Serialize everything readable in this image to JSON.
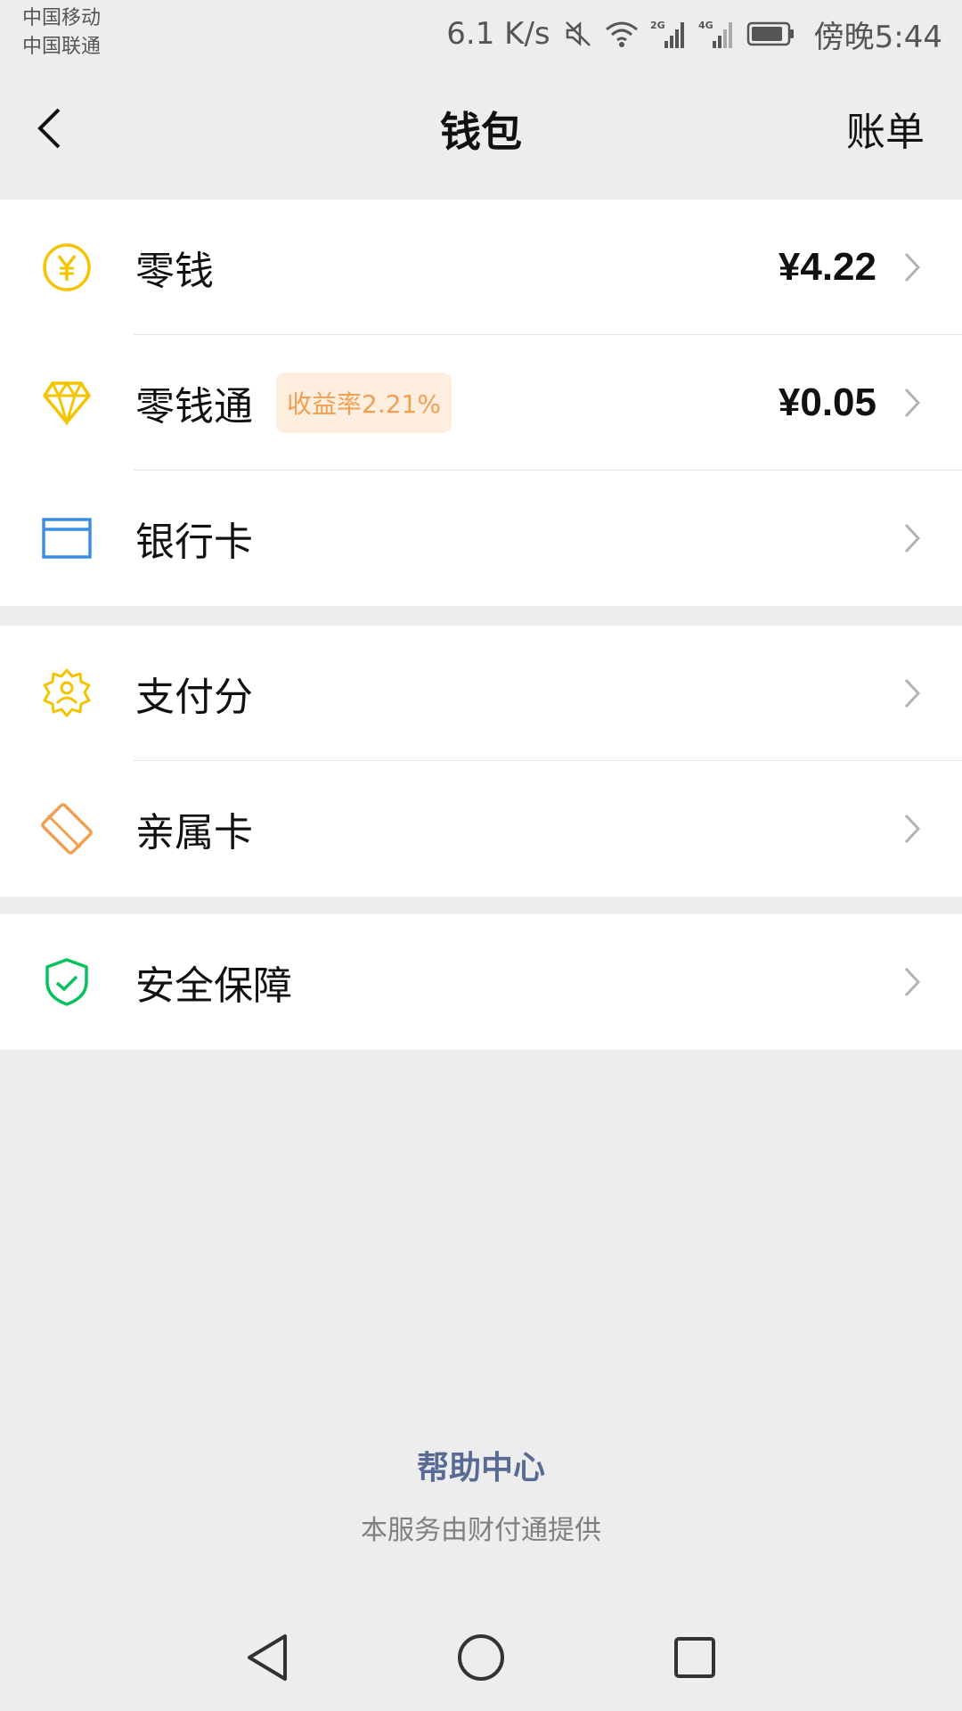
{
  "status_bar": {
    "carrier1": "中国移动",
    "carrier2": "中国联通",
    "speed": "6.1 K/s",
    "time": "傍晚5:44",
    "icons": [
      "mute-icon",
      "wifi-icon",
      "signal-2g-icon",
      "signal-4g-icon",
      "battery-icon"
    ]
  },
  "header": {
    "back_icon": "back-chevron-icon",
    "title": "钱包",
    "bill_label": "账单"
  },
  "sections": {
    "balance": {
      "label": "零钱",
      "amount": "¥4.22",
      "icon": "yuan-coin-icon",
      "icon_color": "#f5c400"
    },
    "licaitong": {
      "label": "零钱通",
      "badge": "收益率2.21%",
      "amount": "¥0.05",
      "icon": "diamond-icon",
      "icon_color": "#f5c400"
    },
    "bank_card": {
      "label": "银行卡",
      "icon": "bank-card-icon",
      "icon_color": "#3a8ee6"
    },
    "pay_score": {
      "label": "支付分",
      "icon": "pay-score-badge-icon",
      "icon_color": "#f5c400"
    },
    "family_card": {
      "label": "亲属卡",
      "icon": "family-card-icon",
      "icon_color": "#f0a050"
    },
    "security": {
      "label": "安全保障",
      "icon": "shield-check-icon",
      "icon_color": "#07c160"
    }
  },
  "footer": {
    "help_center": "帮助中心",
    "provider": "本服务由财付通提供"
  },
  "colors": {
    "background": "#ededed",
    "card": "#ffffff",
    "link": "#576b95",
    "badge_bg": "#fdeee0",
    "badge_text": "#f0a050"
  }
}
